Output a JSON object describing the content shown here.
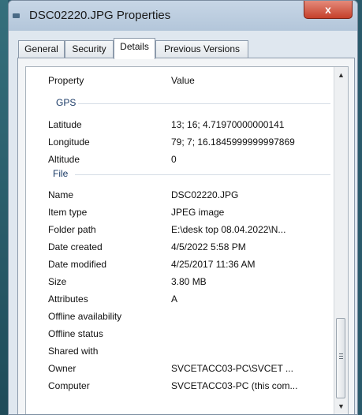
{
  "window": {
    "title": "DSC02220.JPG Properties",
    "close_symbol": "x"
  },
  "tabs": [
    {
      "label": "General"
    },
    {
      "label": "Security"
    },
    {
      "label": "Details",
      "active": true
    },
    {
      "label": "Previous Versions"
    }
  ],
  "details": {
    "header_property": "Property",
    "header_value": "Value",
    "groups": {
      "gps": {
        "label": "GPS",
        "rows": [
          {
            "property": "Latitude",
            "value": "13; 16; 4.71970000000141"
          },
          {
            "property": "Longitude",
            "value": "79; 7; 16.1845999999997869"
          },
          {
            "property": "Altitude",
            "value": "0"
          }
        ]
      },
      "file": {
        "label": "File",
        "rows": [
          {
            "property": "Name",
            "value": "DSC02220.JPG"
          },
          {
            "property": "Item type",
            "value": "JPEG image"
          },
          {
            "property": "Folder path",
            "value": "E:\\desk top 08.04.2022\\N..."
          },
          {
            "property": "Date created",
            "value": "4/5/2022 5:58 PM"
          },
          {
            "property": "Date modified",
            "value": "4/25/2017 11:36 AM"
          },
          {
            "property": "Size",
            "value": "3.80 MB"
          },
          {
            "property": "Attributes",
            "value": "A"
          },
          {
            "property": "Offline availability",
            "value": ""
          },
          {
            "property": "Offline status",
            "value": ""
          },
          {
            "property": "Shared with",
            "value": ""
          },
          {
            "property": "Owner",
            "value": "SVCETACC03-PC\\SVCET ..."
          },
          {
            "property": "Computer",
            "value": "SVCETACC03-PC (this com..."
          }
        ]
      }
    }
  },
  "icons": {
    "scroll_up": "up-arrow",
    "scroll_down": "down-arrow",
    "window": "properties-icon"
  }
}
